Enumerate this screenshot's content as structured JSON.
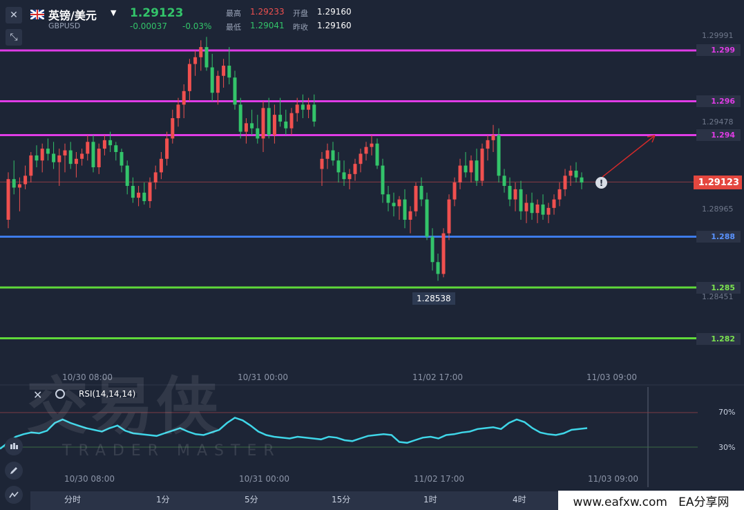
{
  "header": {
    "symbol_name": "英镑/美元",
    "symbol_code": "GBPUSD",
    "price": "1.29123",
    "change": "-0.00037",
    "change_pct": "-0.03%",
    "high_label": "最高",
    "high": "1.29233",
    "open_label": "开盘",
    "open": "1.29160",
    "low_label": "最低",
    "low": "1.29041",
    "prev_label": "昨收",
    "prev": "1.29160"
  },
  "price_scale": [
    "1.29991",
    "1.29478",
    "1.28965",
    "1.28451"
  ],
  "levels": [
    {
      "label": "1.299",
      "color": "#e03ce6"
    },
    {
      "label": "1.296",
      "color": "#e03ce6"
    },
    {
      "label": "1.294",
      "color": "#e03ce6"
    },
    {
      "label": "1.288",
      "color": "#3d7bea"
    },
    {
      "label": "1.285",
      "color": "#5fd93a"
    },
    {
      "label": "1.282",
      "color": "#5fd93a"
    }
  ],
  "current_price_tag": "1.29123",
  "low_marker": "1.28538",
  "time_axis_top": [
    "10/30 08:00",
    "10/31 00:00",
    "11/02 17:00",
    "11/03 09:00"
  ],
  "time_axis_bottom": [
    "10/30 08:00",
    "10/31 00:00",
    "11/02 17:00",
    "11/03 09:00"
  ],
  "rsi": {
    "label": "RSI(14,14,14)",
    "level_high": "70%",
    "level_low": "30%",
    "color": "#3fd6e8"
  },
  "timeframes": [
    "分时",
    "1分",
    "5分",
    "15分",
    "1时",
    "4时"
  ],
  "watermark": {
    "main": "交易侠",
    "sub": "TRADER MASTER"
  },
  "footer_brand": "www.eafxw.com   EA分享网",
  "colors": {
    "up": "#f0504f",
    "down": "#33c46a",
    "bg": "#1d2536"
  },
  "chart_data": {
    "type": "candlestick",
    "title": "英镑/美元 GBPUSD",
    "x": [
      "10/30 08:00",
      "10/31 00:00",
      "11/02 17:00",
      "11/03 09:00"
    ],
    "ylim": [
      1.28,
      1.3008
    ],
    "horizontal_levels": [
      1.299,
      1.296,
      1.294,
      1.288,
      1.285,
      1.282
    ],
    "last_price": 1.29123,
    "marked_low": 1.28538,
    "candles": [
      [
        1.289,
        1.2918,
        1.2885,
        1.2914
      ],
      [
        1.2914,
        1.2925,
        1.2905,
        1.2909
      ],
      [
        1.2909,
        1.2915,
        1.2895,
        1.2911
      ],
      [
        1.2911,
        1.2922,
        1.2908,
        1.2916
      ],
      [
        1.2916,
        1.293,
        1.2912,
        1.2928
      ],
      [
        1.2928,
        1.2934,
        1.2921,
        1.2925
      ],
      [
        1.2925,
        1.2935,
        1.2918,
        1.2932
      ],
      [
        1.2932,
        1.2938,
        1.2925,
        1.2929
      ],
      [
        1.2929,
        1.2936,
        1.292,
        1.2924
      ],
      [
        1.2924,
        1.2932,
        1.291,
        1.2928
      ],
      [
        1.2928,
        1.2935,
        1.2918,
        1.2931
      ],
      [
        1.2931,
        1.2936,
        1.292,
        1.2923
      ],
      [
        1.2923,
        1.293,
        1.2915,
        1.2926
      ],
      [
        1.2926,
        1.2932,
        1.2922,
        1.2929
      ],
      [
        1.2929,
        1.294,
        1.2925,
        1.2936
      ],
      [
        1.2936,
        1.294,
        1.2918,
        1.2921
      ],
      [
        1.2921,
        1.2935,
        1.2917,
        1.2932
      ],
      [
        1.2932,
        1.294,
        1.2928,
        1.2937
      ],
      [
        1.2937,
        1.2942,
        1.293,
        1.2934
      ],
      [
        1.2934,
        1.2936,
        1.2925,
        1.293
      ],
      [
        1.293,
        1.2932,
        1.2918,
        1.2922
      ],
      [
        1.2922,
        1.2925,
        1.2905,
        1.291
      ],
      [
        1.291,
        1.2915,
        1.29,
        1.2903
      ],
      [
        1.2903,
        1.291,
        1.2898,
        1.2906
      ],
      [
        1.2906,
        1.2912,
        1.2899,
        1.2901
      ],
      [
        1.2901,
        1.2915,
        1.2897,
        1.2912
      ],
      [
        1.2912,
        1.2922,
        1.2908,
        1.2918
      ],
      [
        1.2918,
        1.293,
        1.2914,
        1.2926
      ],
      [
        1.2926,
        1.2942,
        1.2922,
        1.2938
      ],
      [
        1.2938,
        1.2955,
        1.2935,
        1.295
      ],
      [
        1.295,
        1.2962,
        1.2945,
        1.2958
      ],
      [
        1.2958,
        1.297,
        1.295,
        1.2966
      ],
      [
        1.2966,
        1.2985,
        1.296,
        1.2982
      ],
      [
        1.2982,
        1.299,
        1.2975,
        1.2986
      ],
      [
        1.2986,
        1.2996,
        1.2978,
        1.2992
      ],
      [
        1.2992,
        1.2998,
        1.2978,
        1.298
      ],
      [
        1.298,
        1.2988,
        1.296,
        1.2965
      ],
      [
        1.2965,
        1.2978,
        1.2958,
        1.2975
      ],
      [
        1.2975,
        1.2985,
        1.2968,
        1.2981
      ],
      [
        1.2981,
        1.2992,
        1.297,
        1.2974
      ],
      [
        1.2974,
        1.2978,
        1.2955,
        1.2958
      ],
      [
        1.2958,
        1.2962,
        1.2938,
        1.2942
      ],
      [
        1.2942,
        1.295,
        1.2935,
        1.2947
      ],
      [
        1.2947,
        1.2955,
        1.294,
        1.2944
      ],
      [
        1.2944,
        1.2952,
        1.2935,
        1.2938
      ],
      [
        1.2938,
        1.296,
        1.293,
        1.2956
      ],
      [
        1.2956,
        1.2962,
        1.2938,
        1.294
      ],
      [
        1.294,
        1.2958,
        1.2935,
        1.2952
      ],
      [
        1.2952,
        1.2962,
        1.2945,
        1.2948
      ],
      [
        1.2948,
        1.2955,
        1.294,
        1.2944
      ],
      [
        1.2944,
        1.2956,
        1.294,
        1.2953
      ],
      [
        1.2953,
        1.2962,
        1.2948,
        1.2958
      ],
      [
        1.2958,
        1.2964,
        1.295,
        1.2955
      ],
      [
        1.2955,
        1.2962,
        1.295,
        1.2958
      ],
      [
        1.2958,
        1.2964,
        1.2945,
        1.2948
      ]
    ],
    "candles_2": [
      [
        1.292,
        1.293,
        1.291,
        1.2926
      ],
      [
        1.2926,
        1.2935,
        1.292,
        1.2931
      ],
      [
        1.2931,
        1.2936,
        1.2922,
        1.2925
      ],
      [
        1.2925,
        1.293,
        1.2912,
        1.2918
      ],
      [
        1.2918,
        1.2925,
        1.291,
        1.2914
      ],
      [
        1.2914,
        1.292,
        1.2908,
        1.2917
      ],
      [
        1.2917,
        1.2926,
        1.2913,
        1.2923
      ],
      [
        1.2923,
        1.2932,
        1.2918,
        1.2929
      ],
      [
        1.2929,
        1.2936,
        1.2925,
        1.2933
      ],
      [
        1.2933,
        1.294,
        1.2928,
        1.2935
      ],
      [
        1.2935,
        1.2938,
        1.292,
        1.2922
      ],
      [
        1.2922,
        1.2926,
        1.29,
        1.2905
      ],
      [
        1.2905,
        1.291,
        1.2895,
        1.29
      ],
      [
        1.29,
        1.2906,
        1.2892,
        1.2898
      ],
      [
        1.2898,
        1.2904,
        1.289,
        1.2902
      ],
      [
        1.2902,
        1.2908,
        1.2885,
        1.289
      ],
      [
        1.289,
        1.2898,
        1.2882,
        1.2895
      ],
      [
        1.2895,
        1.2912,
        1.2892,
        1.291
      ],
      [
        1.291,
        1.2915,
        1.2898,
        1.2902
      ],
      [
        1.2902,
        1.2906,
        1.2878,
        1.288
      ],
      [
        1.288,
        1.2885,
        1.286,
        1.2865
      ],
      [
        1.2865,
        1.287,
        1.2854,
        1.2858
      ],
      [
        1.2858,
        1.2885,
        1.2856,
        1.2882
      ],
      [
        1.2882,
        1.2905,
        1.2878,
        1.2902
      ],
      [
        1.2902,
        1.2915,
        1.2898,
        1.2912
      ],
      [
        1.2912,
        1.2926,
        1.2908,
        1.2922
      ],
      [
        1.2922,
        1.293,
        1.2915,
        1.2918
      ],
      [
        1.2918,
        1.2928,
        1.2912,
        1.2925
      ],
      [
        1.2925,
        1.2932,
        1.291,
        1.2913
      ],
      [
        1.2913,
        1.2935,
        1.291,
        1.2932
      ],
      [
        1.2932,
        1.294,
        1.2925,
        1.2937
      ],
      [
        1.2937,
        1.2946,
        1.293,
        1.294
      ],
      [
        1.294,
        1.2944,
        1.2912,
        1.2916
      ],
      [
        1.2916,
        1.292,
        1.2906,
        1.291
      ],
      [
        1.291,
        1.2915,
        1.2898,
        1.2902
      ],
      [
        1.2902,
        1.2912,
        1.2895,
        1.2908
      ],
      [
        1.2908,
        1.2913,
        1.289,
        1.2895
      ],
      [
        1.2895,
        1.2905,
        1.2888,
        1.29
      ],
      [
        1.29,
        1.2906,
        1.289,
        1.2894
      ],
      [
        1.2894,
        1.2902,
        1.2888,
        1.2899
      ],
      [
        1.2899,
        1.2905,
        1.289,
        1.2893
      ],
      [
        1.2893,
        1.29,
        1.2888,
        1.2897
      ],
      [
        1.2897,
        1.2905,
        1.2893,
        1.2902
      ],
      [
        1.2902,
        1.2912,
        1.2898,
        1.2908
      ],
      [
        1.2908,
        1.292,
        1.2904,
        1.2916
      ],
      [
        1.2916,
        1.2922,
        1.291,
        1.2919
      ],
      [
        1.2919,
        1.2924,
        1.2912,
        1.2915
      ],
      [
        1.2915,
        1.2918,
        1.2908,
        1.2912
      ]
    ],
    "rsi_values": [
      28,
      35,
      42,
      45,
      47,
      46,
      49,
      58,
      62,
      58,
      55,
      52,
      50,
      48,
      52,
      55,
      49,
      46,
      45,
      44,
      43,
      46,
      49,
      52,
      48,
      45,
      44,
      47,
      50,
      58,
      64,
      61,
      55,
      48,
      44,
      42,
      41,
      40,
      42,
      41,
      40,
      39,
      42,
      41,
      38,
      37,
      40,
      43,
      44,
      45,
      44,
      36,
      35,
      38,
      41,
      42,
      40,
      44,
      45,
      47,
      48,
      51,
      52,
      53,
      51,
      58,
      62,
      59,
      52,
      47,
      45,
      44,
      46,
      50,
      51,
      52
    ]
  }
}
